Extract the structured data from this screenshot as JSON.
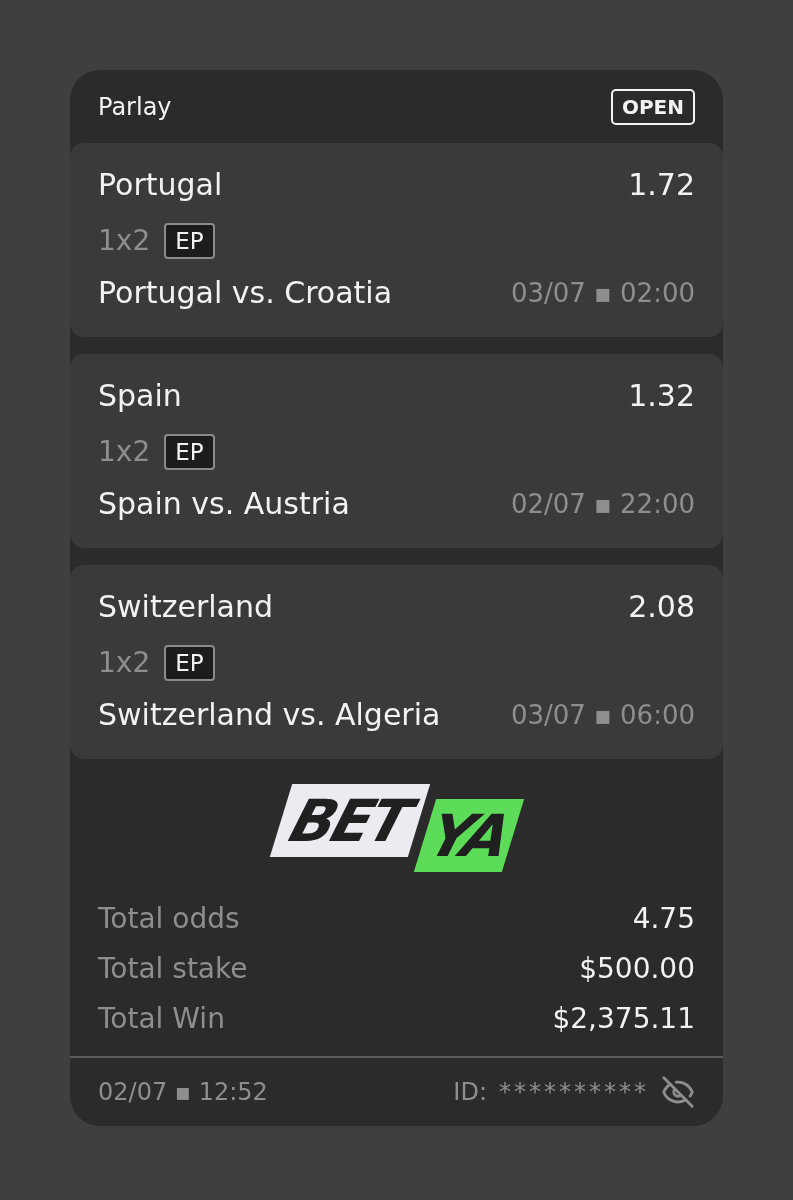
{
  "header": {
    "title": "Parlay",
    "status": "OPEN"
  },
  "legs": [
    {
      "selection": "Portugal",
      "odds": "1.72",
      "market": "1x2",
      "badge": "EP",
      "match": "Portugal vs. Croatia",
      "datetime": "03/07 ▪ 02:00"
    },
    {
      "selection": "Spain",
      "odds": "1.32",
      "market": "1x2",
      "badge": "EP",
      "match": "Spain vs. Austria",
      "datetime": "02/07 ▪ 22:00"
    },
    {
      "selection": "Switzerland",
      "odds": "2.08",
      "market": "1x2",
      "badge": "EP",
      "match": "Switzerland vs. Algeria",
      "datetime": "03/07 ▪ 06:00"
    }
  ],
  "logo": {
    "word_1": "BET",
    "word_2": "YA"
  },
  "totals": [
    {
      "label": "Total odds",
      "value": "4.75"
    },
    {
      "label": "Total stake",
      "value": "$500.00"
    },
    {
      "label": "Total Win",
      "value": "$2,375.11"
    }
  ],
  "footer": {
    "placed_at": "02/07 ▪ 12:52",
    "id_label": "ID:",
    "id_value": "**********",
    "id_hidden": true
  }
}
